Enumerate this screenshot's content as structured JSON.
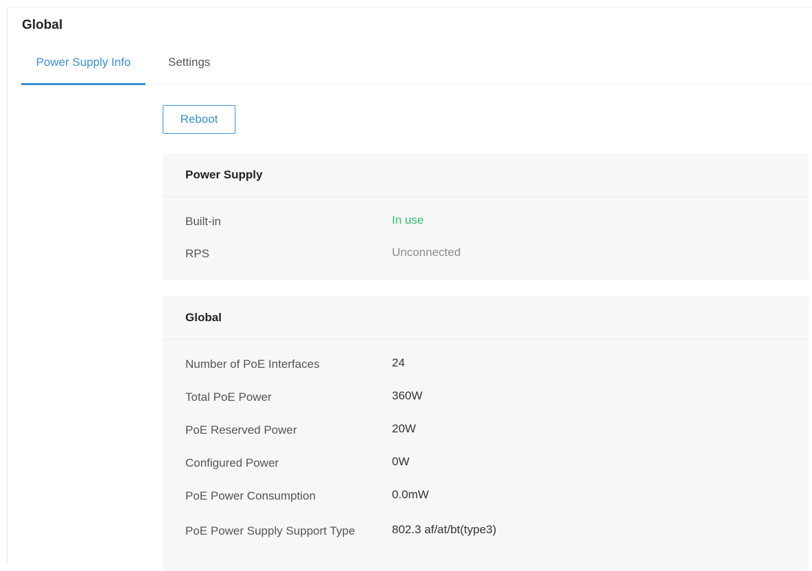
{
  "page": {
    "title": "Global"
  },
  "tabs": [
    {
      "label": "Power Supply Info",
      "active": true
    },
    {
      "label": "Settings",
      "active": false
    }
  ],
  "toolbar": {
    "reboot_label": "Reboot"
  },
  "power_supply": {
    "title": "Power Supply",
    "rows": [
      {
        "label": "Built-in",
        "value": "In use",
        "status_color": "#2fbf71"
      },
      {
        "label": "RPS",
        "value": "Unconnected",
        "status_color": "#8c8c8c"
      }
    ]
  },
  "global": {
    "title": "Global",
    "rows": [
      {
        "label": "Number of PoE Interfaces",
        "value": "24"
      },
      {
        "label": "Total PoE Power",
        "value": "360W"
      },
      {
        "label": "PoE Reserved Power",
        "value": "20W"
      },
      {
        "label": "Configured Power",
        "value": "0W"
      },
      {
        "label": "PoE Power Consumption",
        "value": "0.0mW"
      },
      {
        "label": "PoE Power Supply Support Type",
        "value": "802.3 af/at/bt(type3)"
      }
    ]
  },
  "colors": {
    "accent": "#3a8fd6",
    "status_ok": "#2fbf71",
    "status_muted": "#8c8c8c"
  }
}
